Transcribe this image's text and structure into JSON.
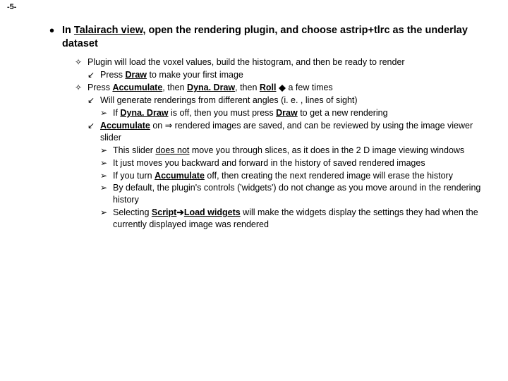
{
  "pagenum": "-5-",
  "top": {
    "pre": "In ",
    "talairach": "Talairach view",
    "mid": ", open the rendering plugin, and choose ",
    "code": "astrip+tlrc",
    "post": " as the underlay dataset"
  },
  "l1a": "Plugin will load the voxel values, build the histogram, and then be ready to render",
  "l1a_sub": {
    "pre": "Press ",
    "draw": "Draw",
    "post": " to make your first image"
  },
  "l1b": {
    "pre": "Press ",
    "acc": "Accumulate",
    "m1": ", then ",
    "dyna": "Dyna. Draw",
    "m2": ", then ",
    "roll": "Roll",
    "post": " a few times"
  },
  "l1b_sub1": "Will generate renderings from different angles (i. e. , lines of sight)",
  "l1b_sub1_s1": {
    "pre": "If ",
    "dyna": "Dyna. Draw",
    "mid": " is off, then you must press ",
    "draw": "Draw",
    "post": " to get a new rendering"
  },
  "l1b_sub2": {
    "acc": "Accumulate",
    "mid": " on ⇒ rendered images are saved, and can be reviewed by using the image viewer slider"
  },
  "l1b_sub2_s1": {
    "pre": "This slider ",
    "u": "does not",
    "post": " move you through slices, as it does in the 2 D image viewing windows"
  },
  "l1b_sub2_s2": "It just moves you backward and forward in the history of saved rendered images",
  "l1b_sub2_s3": {
    "pre": "If you turn ",
    "acc": "Accumulate",
    "post": " off, then creating the next rendered image will erase the history"
  },
  "l1b_sub2_s4": "By default, the plugin's controls ('widgets') do not change as you move around in the rendering history",
  "l1b_sub2_s5": {
    "pre": "Selecting ",
    "s1": "Script",
    "arrow": "➔",
    "s2": "Load widgets",
    "post": " will make the widgets display the settings they had when the currently displayed image was rendered"
  },
  "glyphs": {
    "dot": "•",
    "diamond": "✧",
    "arrow_dl": "↙",
    "tri_r": "➢"
  }
}
